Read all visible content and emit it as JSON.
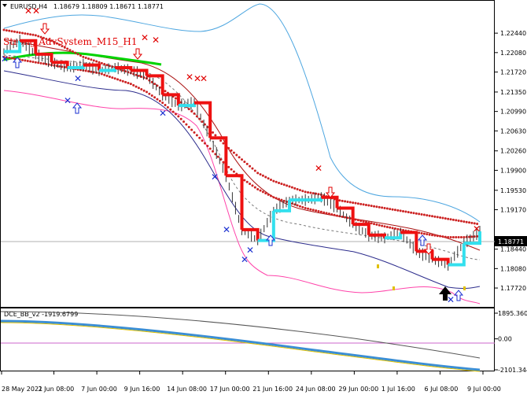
{
  "header": {
    "title": "EURUSD,H4",
    "ohlc": "1.18679 1.18809 1.18671 1.18771",
    "overlay_text": "Strong AdvSystem_M15_H1"
  },
  "colors": {
    "bull_line": "#00d400",
    "bull_step": "#33e0ee",
    "bear_step": "#ee1111",
    "red_dots": "#cc2222",
    "dark_red": "#aa1111",
    "bb_upper": "#4da6e0",
    "bb_lower": "#ff44aa",
    "navy": "#2c2c8c",
    "sub_blue": "#3b8ed4",
    "sub_yellow": "#e0c000",
    "sub_grey": "#555555",
    "sub_pink": "#cc66cc"
  },
  "chart_data": [
    {
      "type": "line",
      "title": "EURUSD,H4",
      "ylim": [
        1.174,
        1.2285
      ],
      "y_ticks": [
        "1.22440",
        "1.22080",
        "1.21720",
        "1.21350",
        "1.20990",
        "1.20630",
        "1.20260",
        "1.19900",
        "1.19530",
        "1.19170",
        "1.18440",
        "1.18080",
        "1.17720"
      ],
      "current_price": "1.18771",
      "x_ticks": [
        "28 May 2021",
        "2 Jun 08:00",
        "7 Jun 00:00",
        "9 Jun 16:00",
        "14 Jun 08:00",
        "17 Jun 00:00",
        "21 Jun 16:00",
        "24 Jun 08:00",
        "29 Jun 00:00",
        "1 Jul 16:00",
        "6 Jul 08:00",
        "9 Jul 00:00"
      ],
      "series": [
        {
          "values": [
            1.221,
            1.223,
            1.2205,
            1.219,
            1.218,
            1.2185,
            1.2175,
            1.218,
            1.2175,
            1.2165,
            1.213,
            1.211,
            1.2115,
            1.205,
            1.198,
            1.188,
            1.186,
            1.1915,
            1.1935,
            1.1935,
            1.194,
            1.192,
            1.189,
            1.187,
            1.1865,
            1.1875,
            1.184,
            1.1825,
            1.1815,
            1.1855,
            1.1877
          ]
        },
        {
          "values": [
            1.225,
            1.2245,
            1.224,
            1.223,
            1.2215,
            1.22,
            1.219,
            1.218,
            1.217,
            1.216,
            1.214,
            1.212,
            1.2095,
            1.2065,
            1.2035,
            1.201,
            1.1985,
            1.197,
            1.196,
            1.195,
            1.1945,
            1.1935,
            1.193,
            1.1925,
            1.192,
            1.1915,
            1.191,
            1.1905,
            1.19,
            1.1895,
            1.189
          ]
        },
        {
          "values": [
            1.22,
            1.2195,
            1.219,
            1.2185,
            1.218,
            1.2175,
            1.217,
            1.216,
            1.215,
            1.2135,
            1.2115,
            1.209,
            1.206,
            1.203,
            1.2,
            1.1975,
            1.1955,
            1.194,
            1.193,
            1.192,
            1.1913,
            1.1906,
            1.19,
            1.1893,
            1.1886,
            1.188,
            1.1875,
            1.187,
            1.1866,
            1.1866,
            1.1868
          ]
        }
      ]
    },
    {
      "type": "line",
      "title": "DCE_BB_v2 -1919.6799",
      "ylim": [
        -2200,
        1950
      ],
      "y_ticks": [
        "1895.3606",
        "0.00",
        "-2101.3446"
      ]
    }
  ]
}
